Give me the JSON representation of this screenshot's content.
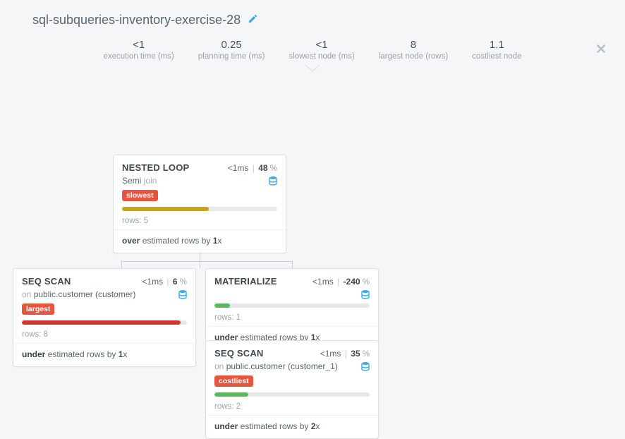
{
  "header": {
    "title": "sql-subqueries-inventory-exercise-28"
  },
  "stats": {
    "execution_time": {
      "value": "<1",
      "label": "execution time (ms)"
    },
    "planning_time": {
      "value": "0.25",
      "label": "planning time (ms)"
    },
    "slowest_node": {
      "value": "<1",
      "label": "slowest node (ms)"
    },
    "largest_node": {
      "value": "8",
      "label": "largest node (rows)"
    },
    "costliest_node": {
      "value": "1.1",
      "label": "costliest node"
    }
  },
  "nodes": {
    "nested_loop": {
      "title": "NESTED LOOP",
      "time": "<1ms",
      "percent": "48",
      "subtype_prefix": "Semi",
      "subtype_suffix": "join",
      "badge": "slowest",
      "bar_width": "56%",
      "bar_class": "bar-gold",
      "rows": "rows: 5",
      "est_prefix": "over",
      "est_mid": " estimated rows by ",
      "est_val": "1",
      "est_suffix": "x"
    },
    "seq_scan_1": {
      "title": "SEQ SCAN",
      "time": "<1ms",
      "percent": "6",
      "on_target": "public.customer (customer)",
      "badge": "largest",
      "bar_width": "96%",
      "bar_class": "bar-red",
      "rows": "rows: 8",
      "est_prefix": "under",
      "est_mid": " estimated rows by ",
      "est_val": "1",
      "est_suffix": "x"
    },
    "materialize": {
      "title": "MATERIALIZE",
      "time": "<1ms",
      "percent": "-240",
      "bar_width": "10%",
      "bar_class": "bar-green",
      "rows": "rows: 1",
      "est_prefix": "under",
      "est_mid": " estimated rows by ",
      "est_val": "1",
      "est_suffix": "x"
    },
    "seq_scan_2": {
      "title": "SEQ SCAN",
      "time": "<1ms",
      "percent": "35",
      "on_target": "public.customer (customer_1)",
      "badge": "costliest",
      "bar_width": "22%",
      "bar_class": "bar-green",
      "rows": "rows: 2",
      "est_prefix": "under",
      "est_mid": " estimated rows by ",
      "est_val": "2",
      "est_suffix": "x"
    }
  },
  "labels": {
    "on": "on ",
    "percent": " %"
  }
}
